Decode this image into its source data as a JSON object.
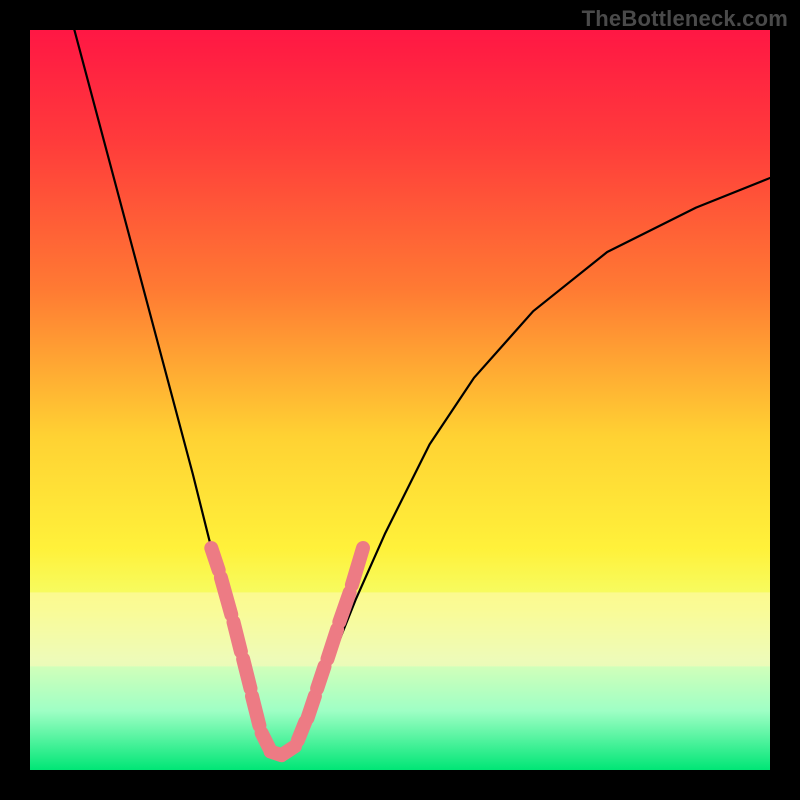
{
  "watermark": "TheBottleneck.com",
  "chart_data": {
    "type": "line",
    "title": "",
    "xlabel": "",
    "ylabel": "",
    "xlim": [
      0,
      100
    ],
    "ylim": [
      0,
      100
    ],
    "gradient_stops": [
      {
        "offset": 0,
        "color": "#ff1744"
      },
      {
        "offset": 15,
        "color": "#ff3b3b"
      },
      {
        "offset": 35,
        "color": "#ff7a33"
      },
      {
        "offset": 55,
        "color": "#ffd233"
      },
      {
        "offset": 70,
        "color": "#fff13a"
      },
      {
        "offset": 78,
        "color": "#f4ff6b"
      },
      {
        "offset": 85,
        "color": "#d9ffb8"
      },
      {
        "offset": 92,
        "color": "#9fffc5"
      },
      {
        "offset": 100,
        "color": "#00e676"
      }
    ],
    "pale_band": {
      "y_from": 76,
      "y_to": 86,
      "color": "#fff8b8",
      "opacity": 0.55
    },
    "curve": {
      "description": "V-shaped bottleneck curve",
      "x": [
        6,
        10,
        14,
        18,
        22,
        24,
        26,
        28,
        30,
        31,
        32,
        33,
        34,
        35,
        36,
        37,
        38,
        40,
        44,
        48,
        54,
        60,
        68,
        78,
        90,
        100
      ],
      "y": [
        0,
        15,
        30,
        45,
        60,
        68,
        76,
        84,
        90,
        94,
        96.5,
        97.5,
        98,
        97.5,
        96.5,
        94.5,
        92,
        87,
        77,
        68,
        56,
        47,
        38,
        30,
        24,
        20
      ]
    },
    "markers": {
      "description": "pink rounded dash segments near valley",
      "color": "#ed7b84",
      "segments": [
        {
          "x1": 24.5,
          "y1": 70,
          "x2": 25.5,
          "y2": 73
        },
        {
          "x1": 25.8,
          "y1": 74,
          "x2": 27.2,
          "y2": 79
        },
        {
          "x1": 27.5,
          "y1": 80,
          "x2": 28.5,
          "y2": 84
        },
        {
          "x1": 28.8,
          "y1": 85,
          "x2": 29.8,
          "y2": 89
        },
        {
          "x1": 30.0,
          "y1": 90,
          "x2": 31.0,
          "y2": 94
        },
        {
          "x1": 31.3,
          "y1": 95,
          "x2": 32.3,
          "y2": 97
        },
        {
          "x1": 32.5,
          "y1": 97.5,
          "x2": 34.0,
          "y2": 98
        },
        {
          "x1": 34.3,
          "y1": 97.8,
          "x2": 35.8,
          "y2": 96.8
        },
        {
          "x1": 36.2,
          "y1": 96,
          "x2": 37.2,
          "y2": 93.5
        },
        {
          "x1": 37.5,
          "y1": 93,
          "x2": 38.5,
          "y2": 90
        },
        {
          "x1": 38.8,
          "y1": 89,
          "x2": 39.8,
          "y2": 86
        },
        {
          "x1": 40.2,
          "y1": 85,
          "x2": 41.5,
          "y2": 81
        },
        {
          "x1": 41.8,
          "y1": 80,
          "x2": 43.2,
          "y2": 76
        },
        {
          "x1": 43.5,
          "y1": 75,
          "x2": 45.0,
          "y2": 70
        }
      ]
    }
  }
}
